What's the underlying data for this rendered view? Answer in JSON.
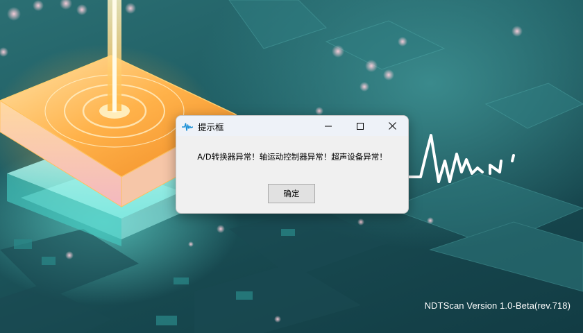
{
  "splash": {
    "version_text": "NDTScan Version 1.0-Beta(rev.718)",
    "logo_icon": "waveform-ndt-logo"
  },
  "dialog": {
    "title": "提示框",
    "icon": "waveform-icon",
    "message": "A/D转换器异常！轴运动控制器异常！超声设备异常！",
    "ok_label": "确定",
    "controls": {
      "minimize_icon": "minimize-icon",
      "maximize_icon": "maximize-icon",
      "close_icon": "close-icon"
    }
  },
  "colors": {
    "accent": "#1a8fd6",
    "titlebar": "#eef2f8",
    "dialog_bg": "#f0f0f0",
    "chip_glow": "#ffb648",
    "teal_bg": "#1f5d63"
  }
}
